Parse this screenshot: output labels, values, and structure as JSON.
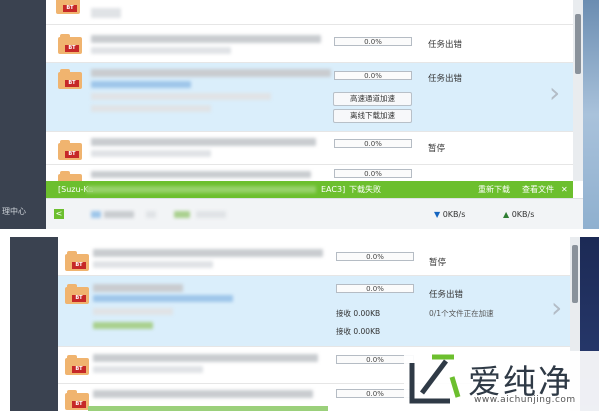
{
  "panel1": {
    "rows": [
      {
        "progress": "0.0%",
        "status": "任务出错"
      },
      {
        "progress": "0.0%",
        "status": "任务出错",
        "buttons": [
          "高速通道加速",
          "离线下载加速"
        ]
      },
      {
        "progress": "0.0%",
        "status": "暂停"
      },
      {
        "progress": "0.0%",
        "status": ""
      }
    ],
    "sidebar_label": "理中心",
    "error_banner": {
      "name_left": "[Suzu-Ka",
      "name_right": "EAC3]",
      "message": "下载失败",
      "retry": "重新下载",
      "view": "查看文件",
      "close": "✕"
    },
    "footer": {
      "back": "<",
      "download_speed": "0KB/s",
      "upload_speed": "0KB/s"
    }
  },
  "panel2": {
    "rows": [
      {
        "progress": "0.0%",
        "status": "暂停"
      },
      {
        "progress": "0.0%",
        "status": "任务出错",
        "recv1": "接收 0.00KB",
        "recv2": "接收 0.00KB",
        "accel": "0/1个文件正在加速"
      },
      {
        "progress": "0.0%",
        "status": ""
      },
      {
        "progress": "0.0%",
        "status": ""
      }
    ]
  },
  "watermark": {
    "text": "爱纯净",
    "url": "www.aichunjing.com"
  },
  "colors": {
    "accent_green": "#6cbf2e",
    "selected_row": "#daeefb",
    "folder": "#f0b46f",
    "bt_tag": "#c62828",
    "sidebar": "#3a4250"
  },
  "icons": [
    "folder-bt-icon",
    "chevron-right-icon",
    "download-arrow-icon",
    "upload-arrow-icon",
    "close-icon"
  ]
}
